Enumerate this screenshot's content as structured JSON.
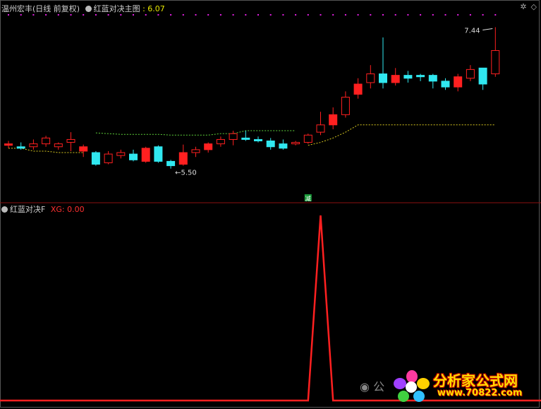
{
  "main_panel": {
    "stock_name": "温州宏丰",
    "period": "(日线 前复权)",
    "indicator_name": "红蓝对决主图",
    "indicator_value": ": 6.07",
    "label_high": "7.44",
    "label_low": "5.50",
    "signal_label": "减"
  },
  "sub_panel": {
    "indicator_name": "红蓝对决F",
    "xg_label": "XG: 0.00"
  },
  "watermark": {
    "brand": "分析家公式网",
    "url": "www.70822.com",
    "wechat": "公"
  },
  "colors": {
    "up": "#ff2020",
    "down": "#30e8f0",
    "support_green": "#5fd33b",
    "support_yellow": "#d8c820",
    "signal": "#ff2020",
    "marker": "#e020e0"
  },
  "chart_data": {
    "type": "candlestick",
    "ylim": [
      5.1,
      7.6
    ],
    "candles": [
      {
        "o": 5.82,
        "h": 5.88,
        "l": 5.78,
        "c": 5.84
      },
      {
        "o": 5.8,
        "h": 5.86,
        "l": 5.76,
        "c": 5.78
      },
      {
        "o": 5.8,
        "h": 5.9,
        "l": 5.76,
        "c": 5.84
      },
      {
        "o": 5.84,
        "h": 5.95,
        "l": 5.8,
        "c": 5.92
      },
      {
        "o": 5.8,
        "h": 5.86,
        "l": 5.76,
        "c": 5.84
      },
      {
        "o": 5.86,
        "h": 6.0,
        "l": 5.74,
        "c": 5.9
      },
      {
        "o": 5.74,
        "h": 5.83,
        "l": 5.66,
        "c": 5.8
      },
      {
        "o": 5.72,
        "h": 5.74,
        "l": 5.54,
        "c": 5.56
      },
      {
        "o": 5.58,
        "h": 5.74,
        "l": 5.56,
        "c": 5.7
      },
      {
        "o": 5.68,
        "h": 5.76,
        "l": 5.64,
        "c": 5.72
      },
      {
        "o": 5.7,
        "h": 5.76,
        "l": 5.6,
        "c": 5.62
      },
      {
        "o": 5.6,
        "h": 5.8,
        "l": 5.58,
        "c": 5.78
      },
      {
        "o": 5.8,
        "h": 5.82,
        "l": 5.58,
        "c": 5.6
      },
      {
        "o": 5.6,
        "h": 5.62,
        "l": 5.5,
        "c": 5.54
      },
      {
        "o": 5.56,
        "h": 5.83,
        "l": 5.54,
        "c": 5.72
      },
      {
        "o": 5.72,
        "h": 5.8,
        "l": 5.66,
        "c": 5.76
      },
      {
        "o": 5.76,
        "h": 5.86,
        "l": 5.72,
        "c": 5.84
      },
      {
        "o": 5.84,
        "h": 5.94,
        "l": 5.8,
        "c": 5.9
      },
      {
        "o": 5.9,
        "h": 6.02,
        "l": 5.82,
        "c": 5.98
      },
      {
        "o": 5.92,
        "h": 6.02,
        "l": 5.88,
        "c": 5.9
      },
      {
        "o": 5.9,
        "h": 5.94,
        "l": 5.86,
        "c": 5.88
      },
      {
        "o": 5.88,
        "h": 5.92,
        "l": 5.76,
        "c": 5.8
      },
      {
        "o": 5.84,
        "h": 5.9,
        "l": 5.76,
        "c": 5.78
      },
      {
        "o": 5.84,
        "h": 5.88,
        "l": 5.82,
        "c": 5.86
      },
      {
        "o": 5.86,
        "h": 5.98,
        "l": 5.84,
        "c": 5.96
      },
      {
        "o": 6.0,
        "h": 6.28,
        "l": 5.96,
        "c": 6.1
      },
      {
        "o": 6.1,
        "h": 6.34,
        "l": 6.04,
        "c": 6.24
      },
      {
        "o": 6.24,
        "h": 6.56,
        "l": 6.2,
        "c": 6.48
      },
      {
        "o": 6.52,
        "h": 6.74,
        "l": 6.46,
        "c": 6.66
      },
      {
        "o": 6.68,
        "h": 6.92,
        "l": 6.6,
        "c": 6.8
      },
      {
        "o": 6.8,
        "h": 7.3,
        "l": 6.6,
        "c": 6.68
      },
      {
        "o": 6.68,
        "h": 6.88,
        "l": 6.64,
        "c": 6.78
      },
      {
        "o": 6.78,
        "h": 6.84,
        "l": 6.68,
        "c": 6.74
      },
      {
        "o": 6.78,
        "h": 6.8,
        "l": 6.7,
        "c": 6.76
      },
      {
        "o": 6.78,
        "h": 6.8,
        "l": 6.6,
        "c": 6.7
      },
      {
        "o": 6.7,
        "h": 6.74,
        "l": 6.58,
        "c": 6.62
      },
      {
        "o": 6.62,
        "h": 6.8,
        "l": 6.56,
        "c": 6.76
      },
      {
        "o": 6.74,
        "h": 6.92,
        "l": 6.7,
        "c": 6.86
      },
      {
        "o": 6.88,
        "h": 6.88,
        "l": 6.58,
        "c": 6.66
      },
      {
        "o": 6.8,
        "h": 7.44,
        "l": 6.76,
        "c": 7.12
      }
    ],
    "support_green": [
      null,
      null,
      null,
      null,
      null,
      null,
      null,
      5.99,
      5.98,
      5.97,
      5.97,
      5.97,
      5.97,
      5.96,
      5.96,
      5.96,
      5.96,
      5.98,
      5.98,
      6.02,
      6.02,
      6.02,
      6.02,
      6.02,
      null,
      null,
      null,
      null,
      null,
      null,
      null,
      null,
      null,
      null,
      null,
      null,
      null,
      null,
      null,
      null
    ],
    "support_yellow": [
      5.78,
      5.78,
      5.74,
      5.74,
      5.72,
      5.72,
      5.72,
      null,
      null,
      null,
      null,
      null,
      null,
      null,
      null,
      null,
      null,
      null,
      null,
      null,
      null,
      null,
      null,
      null,
      5.82,
      5.86,
      5.92,
      6.0,
      6.1,
      6.1,
      6.1,
      6.1,
      6.1,
      6.1,
      6.1,
      6.1,
      6.1,
      6.1,
      6.1,
      6.1
    ],
    "sub_values": [
      0,
      0,
      0,
      0,
      0,
      0,
      0,
      0,
      0,
      0,
      0,
      0,
      0,
      0,
      0,
      0,
      0,
      0,
      0,
      0,
      0,
      0,
      0,
      0,
      0,
      1,
      0,
      0,
      0,
      0,
      0,
      0,
      0,
      0,
      0,
      0,
      0,
      0,
      0,
      0
    ],
    "top_markers": [
      0,
      1,
      2,
      3,
      4,
      5,
      6,
      7,
      8,
      9,
      10,
      11,
      12,
      13,
      14,
      15,
      16,
      17,
      18,
      19,
      20,
      21,
      22,
      23,
      24,
      25,
      26,
      27,
      28,
      29,
      30,
      31,
      32,
      33,
      34,
      35,
      36,
      37,
      38,
      39
    ],
    "high_index": 39,
    "low_index": 13,
    "signal_index": 24
  }
}
